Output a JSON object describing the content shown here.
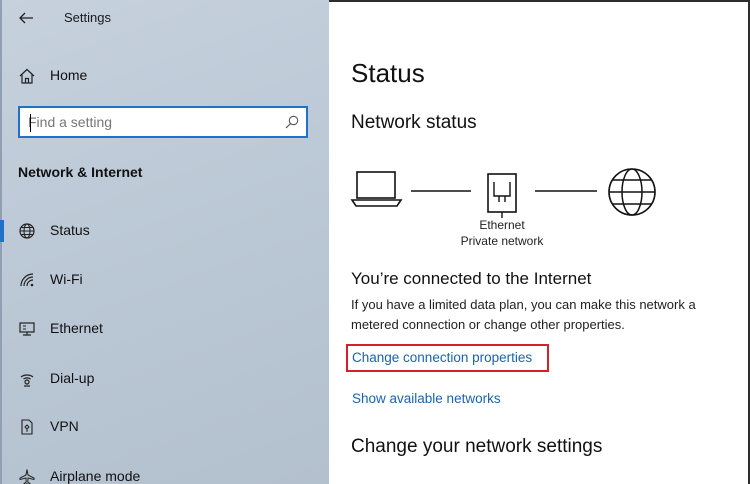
{
  "window": {
    "title": "Settings"
  },
  "sidebar": {
    "home_label": "Home",
    "search": {
      "placeholder": "Find a setting",
      "value": ""
    },
    "section_heading": "Network & Internet",
    "items": [
      {
        "label": "Status",
        "icon": "globe-icon",
        "active": true
      },
      {
        "label": "Wi-Fi",
        "icon": "wifi-icon",
        "active": false
      },
      {
        "label": "Ethernet",
        "icon": "ethernet-icon",
        "active": false
      },
      {
        "label": "Dial-up",
        "icon": "dialup-icon",
        "active": false
      },
      {
        "label": "VPN",
        "icon": "vpn-icon",
        "active": false
      },
      {
        "label": "Airplane mode",
        "icon": "airplane-icon",
        "active": false
      }
    ]
  },
  "main": {
    "page_title": "Status",
    "network_status_heading": "Network status",
    "adapter_name": "Ethernet",
    "network_profile": "Private network",
    "connected_heading": "You’re connected to the Internet",
    "description": "If you have a limited data plan, you can make this network a metered connection or change other properties.",
    "change_properties_link": "Change connection properties",
    "show_networks_link": "Show available networks",
    "change_settings_heading": "Change your network settings"
  },
  "colors": {
    "accent": "#1f72c9",
    "link": "#1a63ae",
    "highlight": "#d61f2c"
  }
}
